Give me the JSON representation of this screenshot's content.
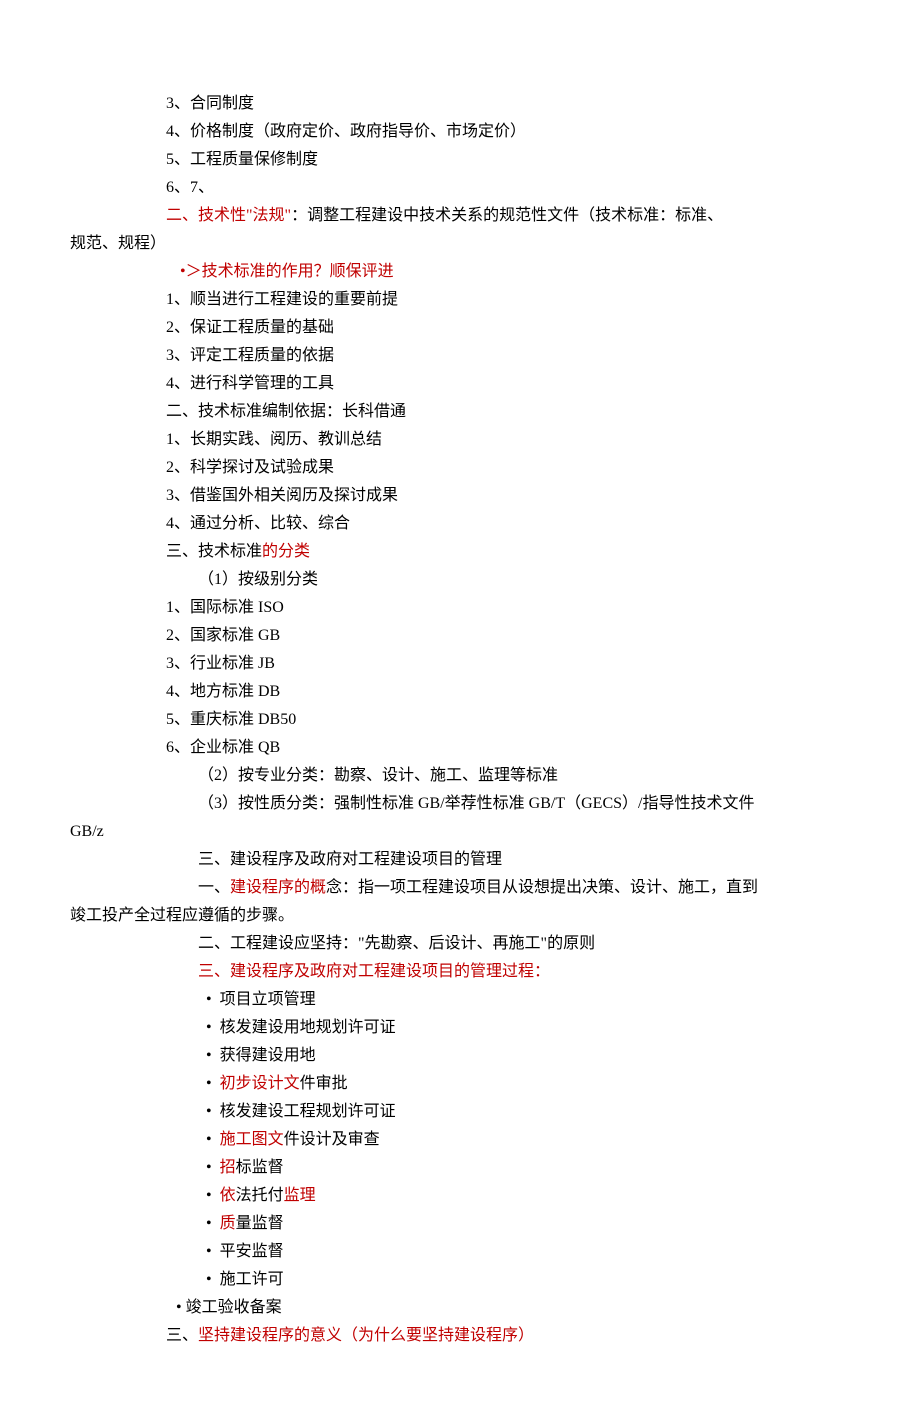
{
  "lines": [
    {
      "cls": "ind1",
      "parts": [
        {
          "t": "3、合同制度"
        }
      ]
    },
    {
      "cls": "ind1",
      "parts": [
        {
          "t": "4、价格制度（政府定价、政府指导价、市场定价）"
        }
      ]
    },
    {
      "cls": "ind1",
      "parts": [
        {
          "t": "5、工程质量保修制度"
        }
      ]
    },
    {
      "cls": "ind1",
      "parts": [
        {
          "t": "6、7、"
        }
      ]
    },
    {
      "cls": "ind1",
      "parts": [
        {
          "t": "二、技术性\"法规\"",
          "red": true
        },
        {
          "t": "：调整工程建设中技术关系的规范性文件（技术标准：标准、"
        }
      ]
    },
    {
      "cls": "ind0",
      "parts": [
        {
          "t": "规范、规程）"
        }
      ]
    },
    {
      "cls": "indB",
      "parts": [
        {
          "t": "•＞技术标准的作用？顺保评进",
          "red": true
        }
      ]
    },
    {
      "cls": "ind1",
      "parts": [
        {
          "t": "1、顺当进行工程建设的重要前提"
        }
      ]
    },
    {
      "cls": "ind1",
      "parts": [
        {
          "t": "2、保证工程质量的基础"
        }
      ]
    },
    {
      "cls": "ind1",
      "parts": [
        {
          "t": "3、评定工程质量的依据"
        }
      ]
    },
    {
      "cls": "ind1",
      "parts": [
        {
          "t": "4、进行科学管理的工具"
        }
      ]
    },
    {
      "cls": "ind1",
      "parts": [
        {
          "t": "二、技术标准编制依据：长科借通"
        }
      ]
    },
    {
      "cls": "ind1",
      "parts": [
        {
          "t": "1、长期实践、阅历、教训总结"
        }
      ]
    },
    {
      "cls": "ind1",
      "parts": [
        {
          "t": "2、科学探讨及试验成果"
        }
      ]
    },
    {
      "cls": "ind1",
      "parts": [
        {
          "t": "3、借鉴国外相关阅历及探讨成果"
        }
      ]
    },
    {
      "cls": "ind1",
      "parts": [
        {
          "t": "4、通过分析、比较、综合"
        }
      ]
    },
    {
      "cls": "ind1",
      "parts": [
        {
          "t": "三、技术标准"
        },
        {
          "t": "的分类",
          "red": true
        }
      ]
    },
    {
      "cls": "indA",
      "parts": [
        {
          "t": "（1）按级别分类"
        }
      ]
    },
    {
      "cls": "ind1",
      "parts": [
        {
          "t": "1、国际标准 ISO"
        }
      ]
    },
    {
      "cls": "ind1",
      "parts": [
        {
          "t": "2、国家标准 GB"
        }
      ]
    },
    {
      "cls": "ind1",
      "parts": [
        {
          "t": "3、行业标准 JB"
        }
      ]
    },
    {
      "cls": "ind1",
      "parts": [
        {
          "t": "4、地方标准 DB"
        }
      ]
    },
    {
      "cls": "ind1",
      "parts": [
        {
          "t": "5、重庆标准 DB50"
        }
      ]
    },
    {
      "cls": "ind1",
      "parts": [
        {
          "t": "6、企业标准 QB"
        }
      ]
    },
    {
      "cls": "indA",
      "parts": [
        {
          "t": "（2）按专业分类：勘察、设计、施工、监理等标准"
        }
      ]
    },
    {
      "cls": "indA",
      "parts": [
        {
          "t": "（3）按性质分类：强制性标准 GB/举荐性标准 GB/T（GECS）/指导性技术文件"
        }
      ]
    },
    {
      "cls": "ind0",
      "parts": [
        {
          "t": "GB/z"
        }
      ]
    },
    {
      "cls": "indA",
      "parts": [
        {
          "t": "三、建设程序及政府对工程建设项目的管理"
        }
      ]
    },
    {
      "cls": "indA",
      "parts": [
        {
          "t": "一、"
        },
        {
          "t": "建设程序的概",
          "red": true
        },
        {
          "t": "念：指一项工程建设项目从设想提出决策、设计、施工，直到"
        }
      ]
    },
    {
      "cls": "ind0",
      "parts": [
        {
          "t": "竣工投产全过程应遵循的步骤。"
        }
      ]
    },
    {
      "cls": "indA",
      "parts": [
        {
          "t": "二、工程建设应坚持：\"先勘察、后设计、再施工\"的原则"
        }
      ]
    },
    {
      "cls": "indA",
      "parts": [
        {
          "t": "三、建设程序及政府对工程建设项目的管理过程：",
          "red": true
        }
      ]
    },
    {
      "cls": "indA",
      "parts": [
        {
          "t": "  •  项目立项管理"
        }
      ]
    },
    {
      "cls": "indA",
      "parts": [
        {
          "t": "  •  核发建设用地规划许可证"
        }
      ]
    },
    {
      "cls": "indA",
      "parts": [
        {
          "t": "  •  获得建设用地"
        }
      ]
    },
    {
      "cls": "indA",
      "parts": [
        {
          "t": "  •  "
        },
        {
          "t": "初步设计文",
          "red": true
        },
        {
          "t": "件审批"
        }
      ]
    },
    {
      "cls": "indA",
      "parts": [
        {
          "t": "  •  核发建设工程规划许可证"
        }
      ]
    },
    {
      "cls": "indA",
      "parts": [
        {
          "t": "  •  "
        },
        {
          "t": "施工图文",
          "red": true
        },
        {
          "t": "件设计及审查"
        }
      ]
    },
    {
      "cls": "indA",
      "parts": [
        {
          "t": "  •  "
        },
        {
          "t": "招",
          "red": true
        },
        {
          "t": "标监督"
        }
      ]
    },
    {
      "cls": "indA",
      "parts": [
        {
          "t": "  •  "
        },
        {
          "t": "依",
          "red": true
        },
        {
          "t": "法托付"
        },
        {
          "t": "监理",
          "red": true
        }
      ]
    },
    {
      "cls": "indA",
      "parts": [
        {
          "t": "  •  "
        },
        {
          "t": "质",
          "red": true
        },
        {
          "t": "量监督"
        }
      ]
    },
    {
      "cls": "indA",
      "parts": [
        {
          "t": "  •  平安监督"
        }
      ]
    },
    {
      "cls": "indA",
      "parts": [
        {
          "t": "  •  施工许可"
        }
      ]
    },
    {
      "cls": "indC",
      "parts": [
        {
          "t": "    • 竣工验收备案"
        }
      ]
    },
    {
      "cls": "ind1",
      "parts": [
        {
          "t": "三、"
        },
        {
          "t": "坚持建设程序的意义（为什么要坚持建设程序）",
          "red": true
        }
      ]
    }
  ]
}
